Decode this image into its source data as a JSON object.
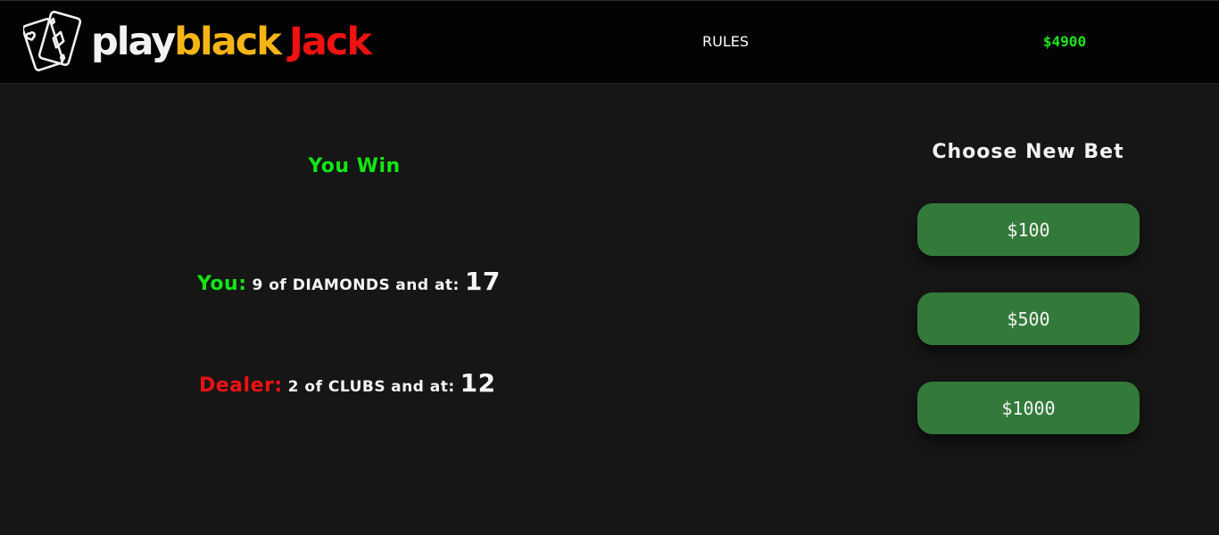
{
  "header": {
    "logo": {
      "icon": "playing-cards-icon",
      "word_play": "play",
      "word_black": "black",
      "word_jack": "Jack",
      "colors": {
        "play": "#f2f2f2",
        "black": "#f6b515",
        "jack": "#f01111"
      }
    },
    "nav_rules_label": "RULES",
    "balance": "$4900",
    "balance_color": "#19e619"
  },
  "game": {
    "result": "You Win",
    "result_color": "#13e613",
    "player": {
      "label": "You:",
      "card": "9 of DIAMONDS",
      "and_at": "and at:",
      "total": "17"
    },
    "dealer": {
      "label": "Dealer:",
      "card": "2 of CLUBS",
      "and_at": "and at:",
      "total": "12"
    }
  },
  "bet_panel": {
    "title": "Choose New Bet",
    "options": [
      "$100",
      "$500",
      "$1000"
    ],
    "button_color": "#337a3a"
  }
}
